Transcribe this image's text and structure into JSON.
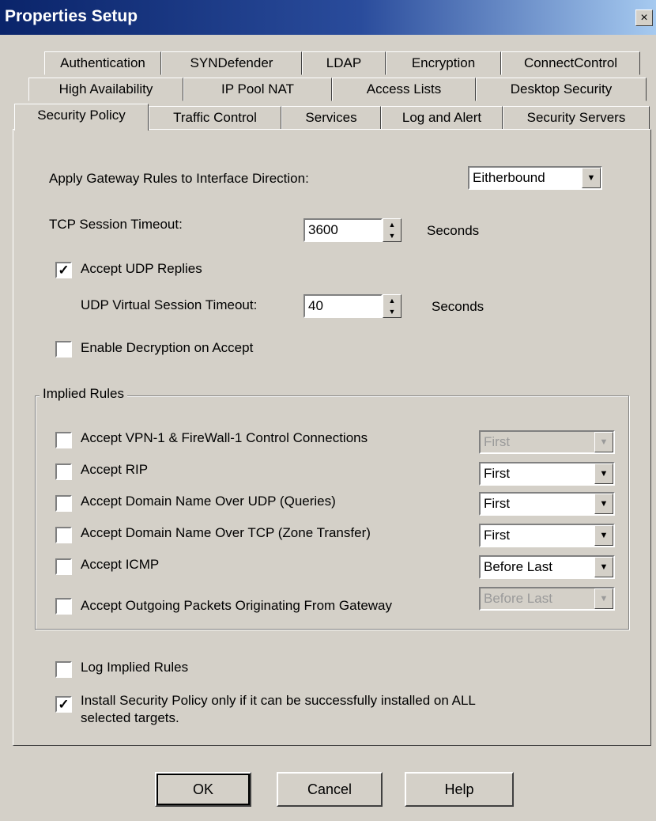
{
  "window": {
    "title": "Properties Setup",
    "close": "×"
  },
  "tabs": {
    "row1": [
      "Authentication",
      "SYNDefender",
      "LDAP",
      "Encryption",
      "ConnectControl"
    ],
    "row2": [
      "High Availability",
      "IP Pool NAT",
      "Access Lists",
      "Desktop Security"
    ],
    "row3": [
      "Security Policy",
      "Traffic Control",
      "Services",
      "Log and Alert",
      "Security Servers"
    ]
  },
  "security_policy": {
    "apply_rules_label": "Apply Gateway Rules to Interface Direction:",
    "direction_value": "Eitherbound",
    "tcp_timeout_label": "TCP Session Timeout:",
    "tcp_timeout_value": "3600",
    "tcp_timeout_unit": "Seconds",
    "accept_udp_label": "Accept UDP Replies",
    "accept_udp_checked": "✓",
    "udp_timeout_label": "UDP Virtual Session Timeout:",
    "udp_timeout_value": "40",
    "udp_timeout_unit": "Seconds",
    "decryption_label": "Enable Decryption on Accept",
    "decryption_checked": ""
  },
  "implied_rules": {
    "group_label": "Implied Rules",
    "items": [
      {
        "label": "Accept VPN-1 & FireWall-1 Control Connections",
        "position": "First",
        "checked": ""
      },
      {
        "label": "Accept RIP",
        "position": "First",
        "checked": ""
      },
      {
        "label": "Accept Domain Name Over UDP (Queries)",
        "position": "First",
        "checked": ""
      },
      {
        "label": "Accept Domain Name Over TCP (Zone Transfer)",
        "position": "First",
        "checked": ""
      },
      {
        "label": "Accept ICMP",
        "position": "Before Last",
        "checked": ""
      },
      {
        "label": "Accept Outgoing Packets Originating From Gateway",
        "position": "Before Last",
        "checked": ""
      }
    ]
  },
  "bottom_options": {
    "log_implied_label": "Log Implied Rules",
    "log_implied_checked": "",
    "install_line1": "Install Security Policy only if it can be successfully installed on ALL",
    "install_line2": "selected targets.",
    "install_checked": "✓"
  },
  "buttons": {
    "ok": "OK",
    "cancel": "Cancel",
    "help": "Help"
  },
  "icons": {
    "dropdown": "▼",
    "spin_up": "▲",
    "spin_down": "▼"
  }
}
